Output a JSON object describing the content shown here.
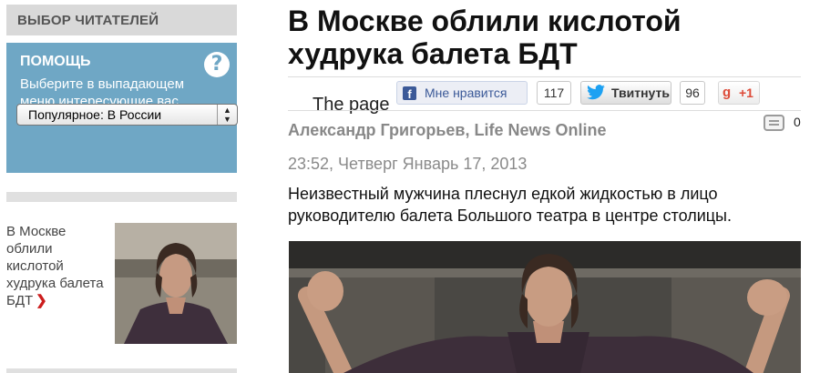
{
  "sidebar": {
    "heading": "ВЫБОР ЧИТАТЕЛЕЙ",
    "help": {
      "title": "ПОМОЩЬ",
      "icon": "question-icon",
      "icon_glyph": "?",
      "text": "Выберите в выпадающем меню интересующие вас разделы новостей."
    },
    "select": {
      "value": "Популярное: В России",
      "arrows": "▲▼"
    },
    "card": {
      "title": "В Москве облили кислотой худрука балета БДТ",
      "arrow": "❯"
    }
  },
  "article": {
    "title": "В Москве облили кислотой худрука балета БДТ",
    "truncated_text": "The page",
    "social": {
      "like_label": "Мне нравится",
      "like_count": "117",
      "tweet_label": "Твитнуть",
      "tweet_count": "96",
      "plus_label": "+1",
      "plus_logo": "g"
    },
    "byline": "Александр Григорьев, Life News Online",
    "comment_count": "0",
    "date": "23:52, Четверг Январь 17, 2013",
    "lead": "Неизвестный мужчина плеснул едкой жидкостью в лицо руководителю балета Большого театра в центре столицы."
  },
  "colors": {
    "help_bg": "#6fa7c5",
    "facebook": "#3b5998",
    "twitter": "#1da1f2",
    "google_plus": "#dd4b39",
    "arrow_red": "#cc1d1d"
  }
}
